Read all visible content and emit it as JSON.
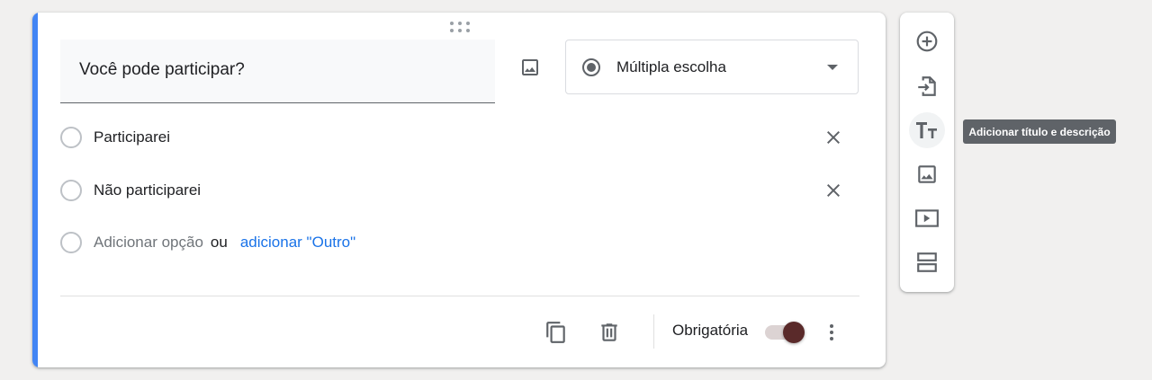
{
  "question": {
    "title": "Você pode participar?",
    "type_label": "Múltipla escolha",
    "options": [
      {
        "label": "Participarei"
      },
      {
        "label": "Não participarei"
      }
    ],
    "add_option_label": "Adicionar opção",
    "or_label": "ou",
    "add_other_label": "adicionar \"Outro\"",
    "required_label": "Obrigatória",
    "required": true
  },
  "toolbar": {
    "tooltip": "Adicionar título e descrição"
  },
  "colors": {
    "accent": "#4285f4",
    "link": "#1a73e8",
    "toggle_knob": "#5a2a2a",
    "icon": "#5f6368"
  }
}
